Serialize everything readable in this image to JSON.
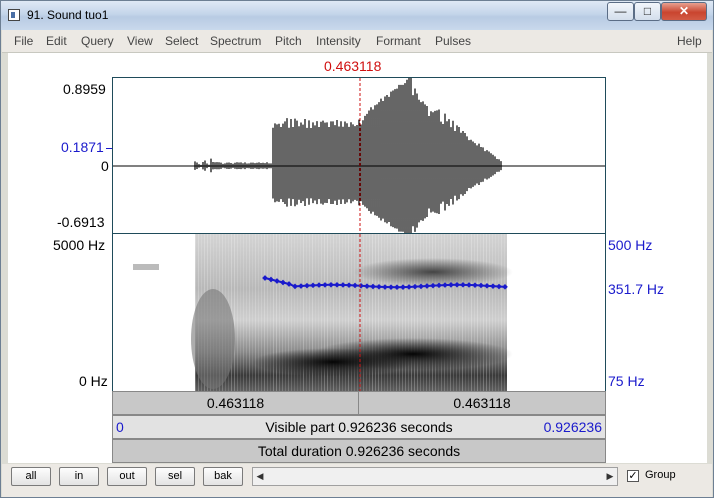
{
  "window": {
    "title": "91. Sound tuo1",
    "minimize_glyph": "—",
    "maximize_glyph": "□",
    "close_glyph": "✕"
  },
  "menu": [
    "File",
    "Edit",
    "Query",
    "View",
    "Select",
    "Spectrum",
    "Pitch",
    "Intensity",
    "Formant",
    "Pulses",
    "Help"
  ],
  "cursor": {
    "time_label": "0.463118",
    "fraction": 0.5
  },
  "waveform": {
    "max_label": "0.8959",
    "cursor_value_label": "0.1871",
    "zero_label": "0",
    "min_label": "-0.6913"
  },
  "spectrogram": {
    "top_freq_label": "5000 Hz",
    "bottom_freq_label": "0 Hz",
    "pitch_top_label": "500 Hz",
    "pitch_mid_label": "351.7 Hz",
    "pitch_bottom_label": "75 Hz"
  },
  "time_bar": {
    "left_label": "0.463118",
    "right_label": "0.463118"
  },
  "visible_bar": {
    "start": "0",
    "label": "Visible part 0.926236 seconds",
    "end": "0.926236"
  },
  "total_bar": {
    "label": "Total duration 0.926236 seconds"
  },
  "buttons": {
    "all": "all",
    "in": "in",
    "out": "out",
    "sel": "sel",
    "bak": "bak"
  },
  "group": {
    "label": "Group",
    "checked": true,
    "check_glyph": "✓"
  },
  "scrollbar": {
    "left_arrow": "◀",
    "right_arrow": "▶"
  },
  "colors": {
    "cursor_line": "#cc1111",
    "pitch": "#1a1acc",
    "label_blue": "#1a1acc"
  }
}
